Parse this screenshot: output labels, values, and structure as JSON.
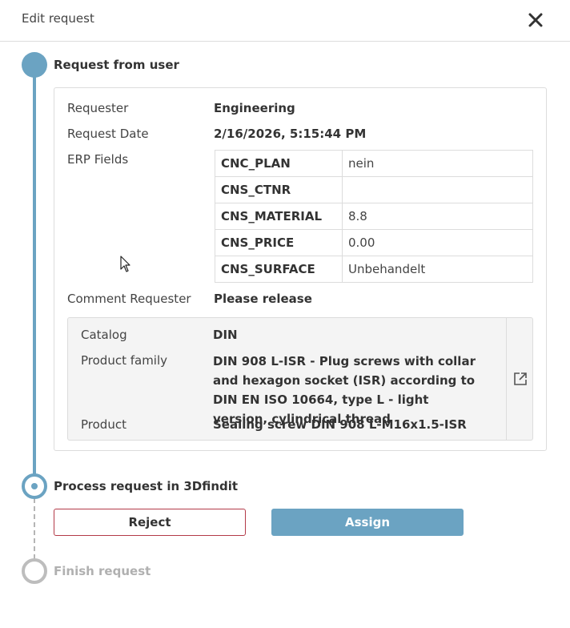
{
  "dialog": {
    "title": "Edit request"
  },
  "steps": [
    {
      "title": "Request from user",
      "state": "completed"
    },
    {
      "title": "Process request in 3Dfindit",
      "state": "active"
    },
    {
      "title": "Finish request",
      "state": "pending"
    }
  ],
  "request": {
    "requester_label": "Requester",
    "requester_value": "Engineering",
    "date_label": "Request Date",
    "date_value": "2/16/2026, 5:15:44 PM",
    "erp_label": "ERP Fields",
    "erp_fields": [
      {
        "key": "CNC_PLAN",
        "value": "nein"
      },
      {
        "key": "CNS_CTNR",
        "value": ""
      },
      {
        "key": "CNS_MATERIAL",
        "value": "8.8"
      },
      {
        "key": "CNS_PRICE",
        "value": "0.00"
      },
      {
        "key": "CNS_SURFACE",
        "value": "Unbehandelt"
      }
    ],
    "comment_label": "Comment Requester",
    "comment_value": "Please release"
  },
  "product": {
    "catalog_label": "Catalog",
    "catalog_value": "DIN",
    "family_label": "Product family",
    "family_value": "DIN 908 L-ISR - Plug screws with collar and hexagon socket (ISR) according to DIN EN ISO 10664, type L - light version, cylindrical thread",
    "product_label": "Product",
    "product_value": "Sealing screw DIN 908 L-M16x1.5-ISR",
    "link_icon": "external-link-icon"
  },
  "actions": {
    "reject_label": "Reject",
    "assign_label": "Assign"
  },
  "colors": {
    "accent": "#6ba3c2",
    "reject_border": "#b33a48",
    "pending": "#bdbdbd"
  }
}
